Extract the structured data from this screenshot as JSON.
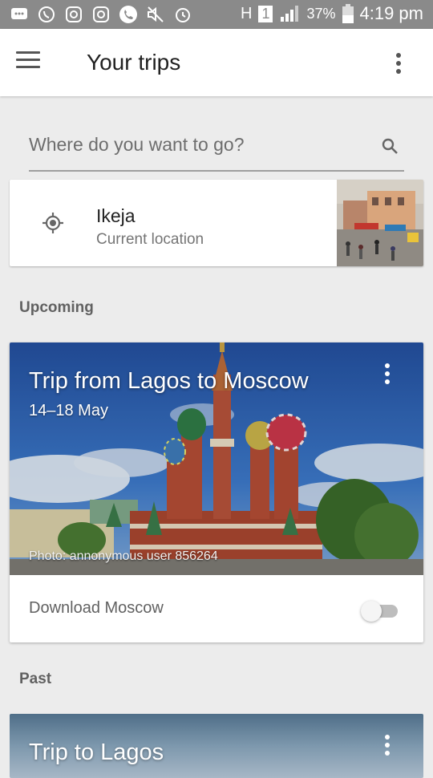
{
  "status_bar": {
    "battery_percent": "37%",
    "time": "4:19 pm",
    "network_label": "H",
    "sim_number": "1",
    "icons": [
      "chat-icon",
      "whatsapp-icon",
      "instagram-icon",
      "instagram-icon",
      "phone-icon",
      "mute-icon",
      "alarm-icon",
      "signal-icon",
      "battery-icon"
    ]
  },
  "app_bar": {
    "title": "Your trips",
    "icons": [
      "menu-icon",
      "more-vert-icon"
    ]
  },
  "search": {
    "placeholder": "Where do you want to go?",
    "icon": "search-icon"
  },
  "current_location": {
    "name": "Ikeja",
    "subtitle": "Current location",
    "icon": "my-location-icon"
  },
  "sections": {
    "upcoming": "Upcoming",
    "past": "Past"
  },
  "upcoming_trip": {
    "title": "Trip from Lagos to Moscow",
    "dates": "14–18 May",
    "photo_credit": "Photo: annonymous user 856264",
    "download_label": "Download Moscow",
    "download_enabled": false
  },
  "past_trip": {
    "title": "Trip to Lagos"
  },
  "colors": {
    "status_bar": "#8a8a8a",
    "background": "#ececec",
    "sky": "#2f64b8"
  }
}
